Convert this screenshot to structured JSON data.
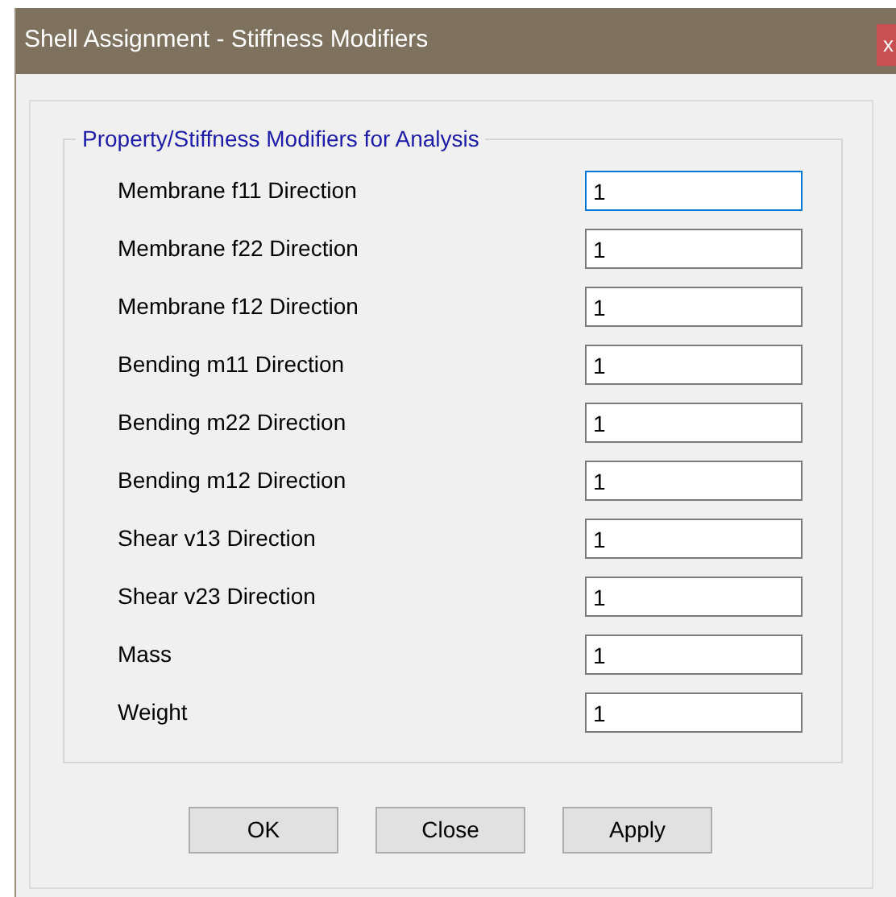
{
  "window": {
    "title": "Shell Assignment - Stiffness Modifiers",
    "close": "x"
  },
  "group": {
    "title": "Property/Stiffness Modifiers for Analysis",
    "fields": [
      {
        "label": "Membrane f11 Direction",
        "value": "1",
        "focused": true
      },
      {
        "label": "Membrane f22 Direction",
        "value": "1",
        "focused": false
      },
      {
        "label": "Membrane f12 Direction",
        "value": "1",
        "focused": false
      },
      {
        "label": "Bending m11 Direction",
        "value": "1",
        "focused": false
      },
      {
        "label": "Bending m22 Direction",
        "value": "1",
        "focused": false
      },
      {
        "label": "Bending m12 Direction",
        "value": "1",
        "focused": false
      },
      {
        "label": "Shear v13 Direction",
        "value": "1",
        "focused": false
      },
      {
        "label": "Shear v23 Direction",
        "value": "1",
        "focused": false
      },
      {
        "label": "Mass",
        "value": "1",
        "focused": false
      },
      {
        "label": "Weight",
        "value": "1",
        "focused": false
      }
    ]
  },
  "buttons": [
    "OK",
    "Close",
    "Apply"
  ]
}
